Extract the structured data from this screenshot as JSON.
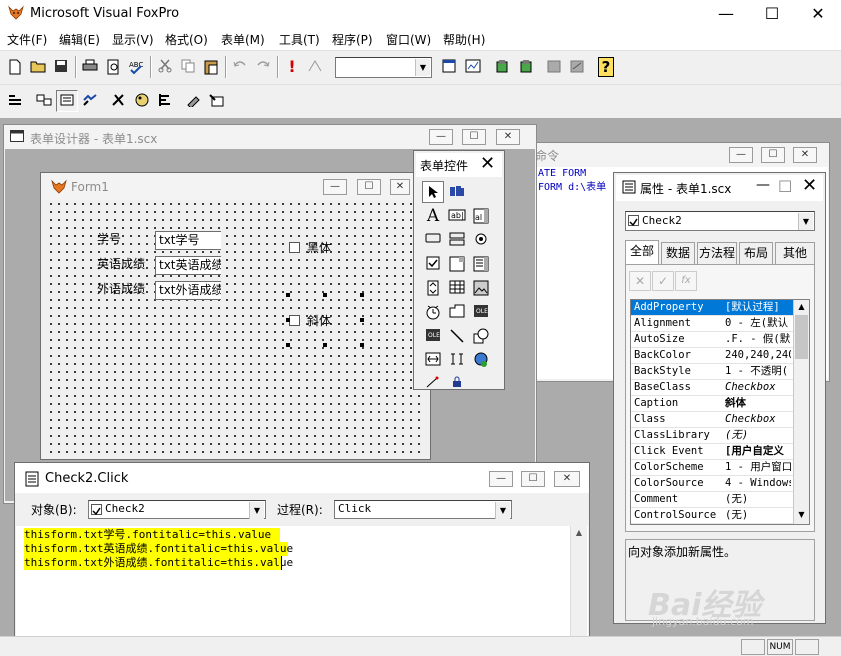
{
  "app": {
    "title": "Microsoft Visual FoxPro",
    "minimize": "—",
    "maximize": "☐",
    "close": "✕"
  },
  "menu": [
    "文件(F)",
    "编辑(E)",
    "显示(V)",
    "格式(O)",
    "表单(M)",
    "工具(T)",
    "程序(P)",
    "窗口(W)",
    "帮助(H)"
  ],
  "form_designer": {
    "title": "表单设计器 - 表单1.scx",
    "form_title": "Form1",
    "labels": [
      "学号",
      "英语成绩",
      "外语成绩"
    ],
    "textboxes": [
      "txt学号",
      "txt英语成绩",
      "txt外语成绩"
    ],
    "check1": "黑体",
    "check2": "斜体"
  },
  "toolbox": {
    "title": "表单控件"
  },
  "command_window": {
    "title": "命令",
    "lines": [
      "ATE FORM",
      "FORM d:\\表单"
    ]
  },
  "properties": {
    "title": "属性 - 表单1.scx",
    "object": "Check2",
    "tabs": [
      "全部",
      "数据",
      "方法程",
      "布局",
      "其他"
    ],
    "rows": [
      {
        "name": "AddProperty",
        "value": "[默认过程]"
      },
      {
        "name": "Alignment",
        "value": "0 - 左(默认"
      },
      {
        "name": "AutoSize",
        "value": ".F. - 假(默"
      },
      {
        "name": "BackColor",
        "value": "240,240,240"
      },
      {
        "name": "BackStyle",
        "value": "1 - 不透明("
      },
      {
        "name": "BaseClass",
        "value": "Checkbox"
      },
      {
        "name": "Caption",
        "value": "斜体"
      },
      {
        "name": "Class",
        "value": "Checkbox"
      },
      {
        "name": "ClassLibrary",
        "value": "(无)"
      },
      {
        "name": "Click Event",
        "value": "[用户自定义"
      },
      {
        "name": "ColorScheme",
        "value": "1 - 用户窗口"
      },
      {
        "name": "ColorSource",
        "value": "4 - Windows"
      },
      {
        "name": "Comment",
        "value": "(无)"
      },
      {
        "name": "ControlSource",
        "value": "(无)"
      }
    ],
    "description": "向对象添加新属性。"
  },
  "code_window": {
    "title": "Check2.Click",
    "object_label": "对象(B):",
    "object_value": "Check2",
    "procedure_label": "过程(R):",
    "procedure_value": "Click",
    "lines": [
      "thisform.txt学号.fontitalic=this.value",
      "thisform.txt英语成绩.fontitalic=this.value",
      "thisform.txt外语成绩.fontitalic=this.value"
    ]
  },
  "status": {
    "num": "NUM"
  },
  "watermark": {
    "brand": "Bai经验",
    "url": "jingyan.baidu.com"
  },
  "colors": {
    "selection": "#0078d7",
    "code_highlight": "#ffff00",
    "workspace": "#ababab"
  }
}
